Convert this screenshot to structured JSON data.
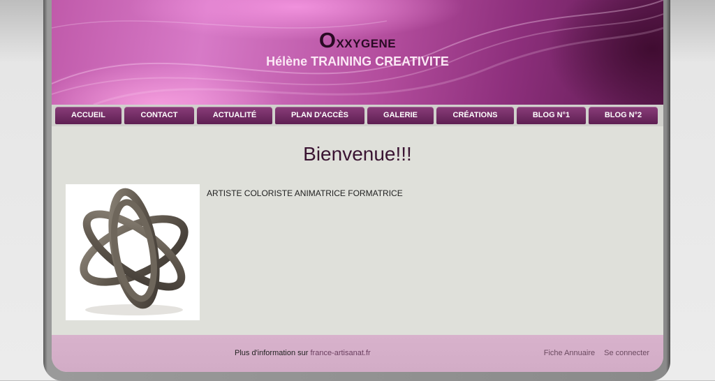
{
  "header": {
    "title": "Oxxygene",
    "title_first": "O",
    "title_rest": "xxygene",
    "subtitle": "Hélène TRAINING CREATIVITE"
  },
  "nav": {
    "items": [
      {
        "label": "ACCUEIL"
      },
      {
        "label": "CONTACT"
      },
      {
        "label": "ACTUALITÉ"
      },
      {
        "label": "PLAN D'ACCÈS"
      },
      {
        "label": "GALERIE"
      },
      {
        "label": "CRÉATIONS"
      },
      {
        "label": "BLOG N°1"
      },
      {
        "label": "BLOG N°2"
      }
    ]
  },
  "content": {
    "title": "Bienvenue!!!",
    "text": "ARTISTE COLORISTE ANIMATRICE FORMATRICE"
  },
  "footer": {
    "info_prefix": "Plus d'information sur ",
    "info_link": "france-artisanat.fr",
    "links": [
      "Fiche Annuaire",
      "Se connecter"
    ]
  },
  "colors": {
    "accent": "#7a2e6c",
    "header_dark": "#5b1a4e",
    "content_bg": "#dfe0da",
    "footer_bg": "#d8b2cc"
  }
}
